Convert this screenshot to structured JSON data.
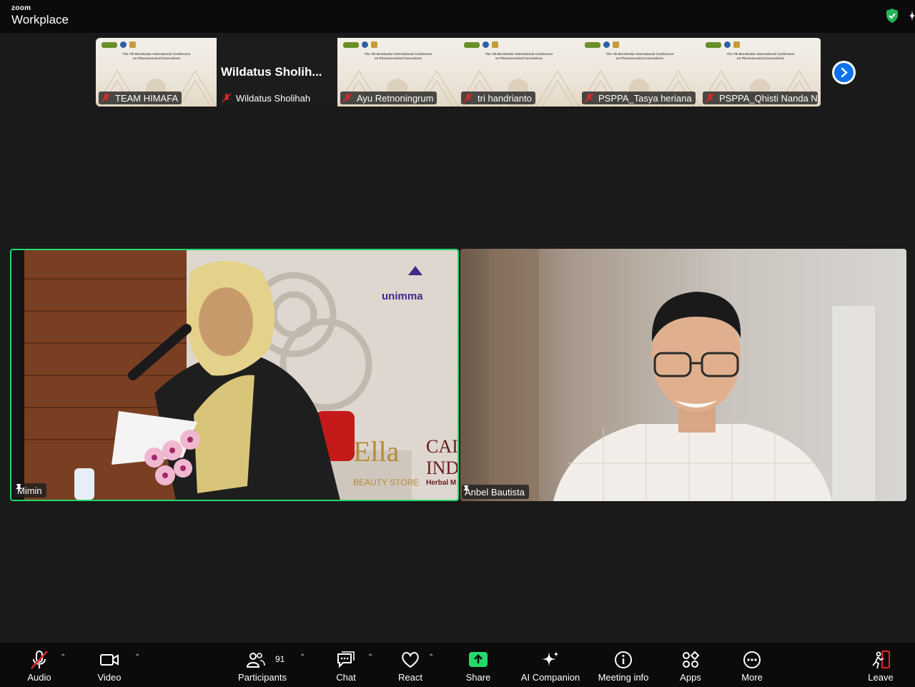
{
  "app": {
    "brand_small": "zoom",
    "brand_name": "Workplace"
  },
  "thumbnails": [
    {
      "name": "TEAM HIMAFA",
      "type": "slide",
      "conf_line1": "The 7th Borobudur International Conference",
      "conf_line2": "on Pharmaceutical Innovations"
    },
    {
      "name": "Wildatus Sholihah",
      "type": "name-card",
      "display": "Wildatus  Sholih..."
    },
    {
      "name": "Ayu Retnoningrum",
      "type": "slide",
      "conf_line1": "The 7th Borobudur International Conference",
      "conf_line2": "on Pharmaceutical Innovations"
    },
    {
      "name": "tri handrianto",
      "type": "slide",
      "conf_line1": "The 7th Borobudur International Conference",
      "conf_line2": "on Pharmaceutical Innovations"
    },
    {
      "name": "PSPPA_Tasya heriana",
      "type": "slide",
      "conf_line1": "The 7th Borobudur International Conference",
      "conf_line2": "on Pharmaceutical Innovations"
    },
    {
      "name": "PSPPA_Qhisti Nanda N...",
      "type": "slide",
      "conf_line1": "The 7th Borobudur International Conference",
      "conf_line2": "on Pharmaceutical Innovations"
    }
  ],
  "main_videos": [
    {
      "name": "Mimin",
      "active_speaker": true,
      "backdrop_text": {
        "logo": "unimma",
        "brand1": "Ella",
        "brand1_sub": "BEAUTY STORE",
        "brand2a": "CAI",
        "brand2b": "IND",
        "brand2c": "Herbal M"
      }
    },
    {
      "name": "Anbel Bautista",
      "active_speaker": false
    }
  ],
  "toolbar": {
    "audio": "Audio",
    "video": "Video",
    "participants": "Participants",
    "participants_count": "91",
    "chat": "Chat",
    "react": "React",
    "share": "Share",
    "ai_companion": "AI Companion",
    "meeting_info": "Meeting info",
    "apps": "Apps",
    "more": "More",
    "leave": "Leave"
  },
  "colors": {
    "active_speaker": "#23d96c",
    "share": "#23d96c",
    "muted": "#e02828",
    "leave": "#e02828",
    "next": "#0e72ed"
  }
}
